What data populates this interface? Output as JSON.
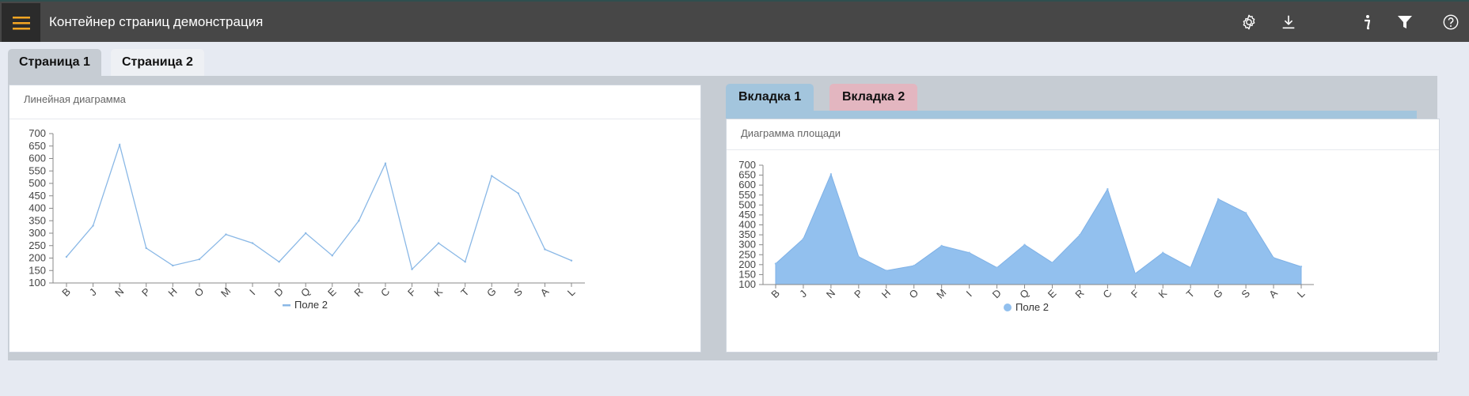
{
  "header": {
    "title": "Контейнер страниц демонстрация",
    "accent": "#f5a623",
    "icons": [
      "menu-icon",
      "gear-icon",
      "download-icon",
      "info-icon",
      "filter-icon",
      "help-icon"
    ]
  },
  "page_tabs": [
    {
      "label": "Страница 1",
      "active": true
    },
    {
      "label": "Страница 2",
      "active": false
    }
  ],
  "line_panel": {
    "title": "Линейная диаграмма"
  },
  "inner_tabs": [
    {
      "label": "Вкладка 1",
      "color": "#a3c5dd"
    },
    {
      "label": "Вкладка 2",
      "color": "#e3b6c0"
    }
  ],
  "area_panel": {
    "title": "Диаграмма площади"
  },
  "chart_data": [
    {
      "type": "line",
      "title": "Линейная диаграмма",
      "categories": [
        "B",
        "J",
        "N",
        "P",
        "H",
        "O",
        "M",
        "I",
        "D",
        "Q",
        "E",
        "R",
        "C",
        "F",
        "K",
        "T",
        "G",
        "S",
        "A",
        "L"
      ],
      "series": [
        {
          "name": "Поле 2",
          "values": [
            205,
            330,
            655,
            240,
            170,
            195,
            295,
            260,
            185,
            300,
            210,
            350,
            580,
            155,
            260,
            185,
            530,
            460,
            235,
            190
          ],
          "color": "#8ab8e6"
        }
      ],
      "ylim": [
        100,
        700
      ],
      "yticks": [
        100,
        150,
        200,
        250,
        300,
        350,
        400,
        450,
        500,
        550,
        600,
        650,
        700
      ],
      "legend": "bottom"
    },
    {
      "type": "area",
      "title": "Диаграмма площади",
      "categories": [
        "B",
        "J",
        "N",
        "P",
        "H",
        "O",
        "M",
        "I",
        "D",
        "Q",
        "E",
        "R",
        "C",
        "F",
        "K",
        "T",
        "G",
        "S",
        "A",
        "L"
      ],
      "series": [
        {
          "name": "Поле 2",
          "values": [
            205,
            330,
            655,
            240,
            170,
            195,
            295,
            260,
            185,
            300,
            210,
            350,
            580,
            155,
            260,
            185,
            530,
            460,
            235,
            190
          ],
          "color": "#92c0ee"
        }
      ],
      "ylim": [
        100,
        700
      ],
      "yticks": [
        100,
        150,
        200,
        250,
        300,
        350,
        400,
        450,
        500,
        550,
        600,
        650,
        700
      ],
      "legend": "bottom"
    }
  ]
}
